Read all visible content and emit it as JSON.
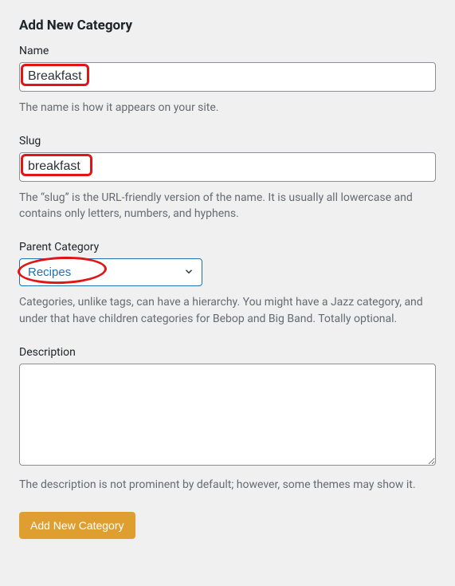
{
  "title": "Add New Category",
  "fields": {
    "name": {
      "label": "Name",
      "value": "Breakfast",
      "help": "The name is how it appears on your site."
    },
    "slug": {
      "label": "Slug",
      "value": "breakfast",
      "help": "The “slug” is the URL-friendly version of the name. It is usually all lowercase and contains only letters, numbers, and hyphens."
    },
    "parent": {
      "label": "Parent Category",
      "selected": "Recipes",
      "help": "Categories, unlike tags, can have a hierarchy. You might have a Jazz category, and under that have children categories for Bebop and Big Band. Totally optional."
    },
    "description": {
      "label": "Description",
      "value": "",
      "help": "The description is not prominent by default; however, some themes may show it."
    }
  },
  "submit_label": "Add New Category",
  "colors": {
    "highlight": "#e11515",
    "accent": "#2271b1",
    "button": "#df9f30"
  }
}
